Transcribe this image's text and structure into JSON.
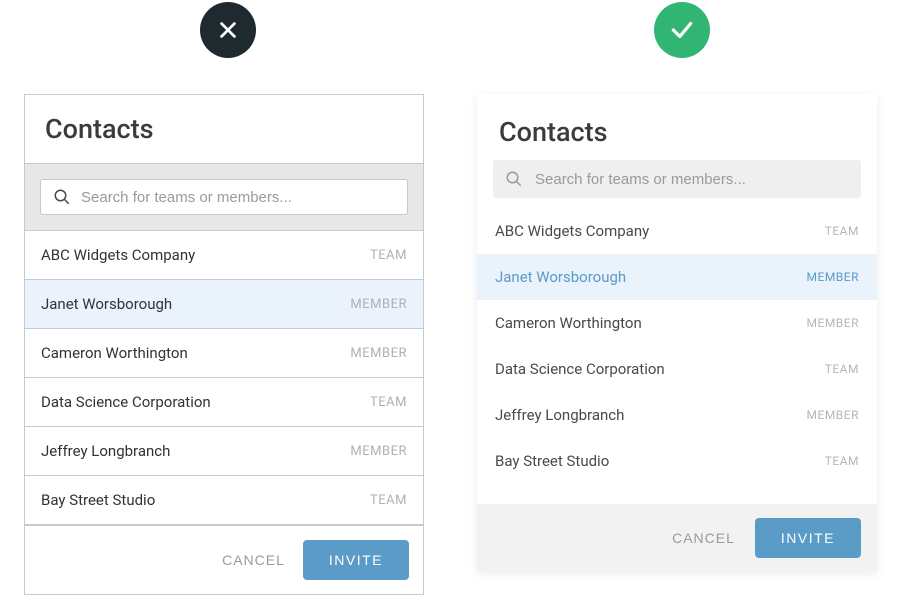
{
  "badges": {
    "bad": "cross-icon",
    "good": "check-icon"
  },
  "colors": {
    "accent": "#5a9bc8",
    "success": "#31b573",
    "dark": "#1f2a30",
    "muted": "#9a9a9a",
    "selected_bg": "#eaf3fb"
  },
  "left": {
    "title": "Contacts",
    "search_placeholder": "Search for teams or members...",
    "rows": [
      {
        "name": "ABC Widgets Company",
        "type": "TEAM",
        "selected": false
      },
      {
        "name": "Janet Worsborough",
        "type": "MEMBER",
        "selected": true
      },
      {
        "name": "Cameron Worthington",
        "type": "MEMBER",
        "selected": false
      },
      {
        "name": "Data Science Corporation",
        "type": "TEAM",
        "selected": false
      },
      {
        "name": "Jeffrey Longbranch",
        "type": "MEMBER",
        "selected": false
      },
      {
        "name": "Bay Street Studio",
        "type": "TEAM",
        "selected": false
      }
    ],
    "cancel_label": "CANCEL",
    "invite_label": "INVITE"
  },
  "right": {
    "title": "Contacts",
    "search_placeholder": "Search for teams or members...",
    "rows": [
      {
        "name": "ABC Widgets Company",
        "type": "TEAM",
        "selected": false
      },
      {
        "name": "Janet Worsborough",
        "type": "MEMBER",
        "selected": true
      },
      {
        "name": "Cameron Worthington",
        "type": "MEMBER",
        "selected": false
      },
      {
        "name": "Data Science Corporation",
        "type": "TEAM",
        "selected": false
      },
      {
        "name": "Jeffrey Longbranch",
        "type": "MEMBER",
        "selected": false
      },
      {
        "name": "Bay Street Studio",
        "type": "TEAM",
        "selected": false
      }
    ],
    "cancel_label": "CANCEL",
    "invite_label": "INVITE"
  }
}
